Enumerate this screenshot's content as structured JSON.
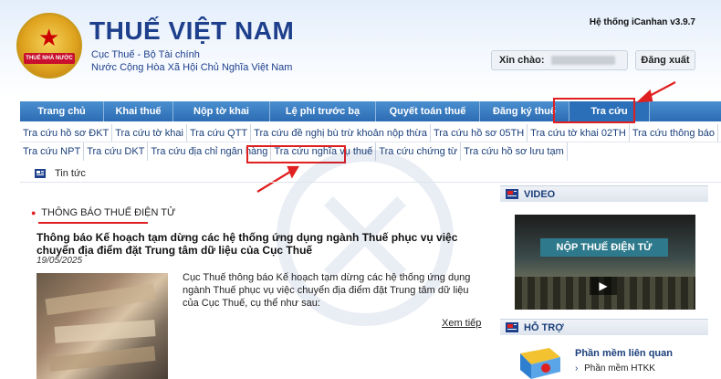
{
  "header": {
    "title": "THUẾ VIỆT NAM",
    "subtitle1": "Cục Thuế - Bộ Tài chính",
    "subtitle2": "Nước Cộng Hòa Xã Hội Chủ Nghĩa Việt Nam",
    "version": "Hệ thống iCanhan v3.9.7",
    "greeting_label": "Xin chào:",
    "logout_label": "Đăng xuất",
    "emblem_text": "THUẾ NHÀ NƯỚC"
  },
  "nav": {
    "items": [
      {
        "label": "Trang chủ"
      },
      {
        "label": "Khai thuế"
      },
      {
        "label": "Nộp tờ khai"
      },
      {
        "label": "Lệ phí trước bạ"
      },
      {
        "label": "Quyết toán thuế"
      },
      {
        "label": "Đăng ký thuế"
      },
      {
        "label": "Tra cứu"
      }
    ],
    "active": "Tra cứu"
  },
  "subnav": {
    "row1": [
      {
        "label": "Tra cứu hồ sơ ĐKT"
      },
      {
        "label": "Tra cứu tờ khai"
      },
      {
        "label": "Tra cứu QTT"
      },
      {
        "label": "Tra cứu đề nghị bù trừ khoản nộp thừa"
      },
      {
        "label": "Tra cứu hồ sơ 05TH"
      },
      {
        "label": "Tra cứu tờ khai 02TH"
      },
      {
        "label": "Tra cứu thông báo"
      }
    ],
    "row2": [
      {
        "label": "Tra cứu NPT"
      },
      {
        "label": "Tra cứu DKT"
      },
      {
        "label": "Tra cứu địa chỉ ngân hàng"
      },
      {
        "label": "Tra cứu nghĩa vụ thuế"
      },
      {
        "label": "Tra cứu chứng từ"
      },
      {
        "label": "Tra cứu hồ sơ lưu tạm"
      }
    ],
    "highlighted": "Tra cứu nghĩa vụ thuế"
  },
  "news_bar": {
    "label": "Tin tức"
  },
  "main": {
    "section_title": "THÔNG BÁO THUẾ ĐIỆN TỬ",
    "news_title": "Thông báo Kế hoạch tạm dừng các hệ thống ứng dụng ngành Thuế phục vụ việc chuyển địa điểm đặt Trung tâm dữ liệu của Cục Thuế",
    "news_date": "19/05/2025",
    "news_body": "Cục Thuế thông báo Kế hoạch tạm dừng các hệ thống ứng dụng ngành Thuế phục vụ việc chuyển địa điểm đặt Trung tâm dữ liệu của Cục Thuế, cụ thể như sau:",
    "more_label": "Xem tiếp"
  },
  "sidebar": {
    "video_label": "VIDEO",
    "video_caption": "NỘP THUẾ ĐIỆN TỬ",
    "support_label": "HỖ TRỢ",
    "support_title": "Phần mềm liên quan",
    "support_item": "Phần mềm HTKK"
  },
  "colors": {
    "nav_bg": "#2d6cb3",
    "brand_blue": "#1d3f8c",
    "highlight_red": "#e02020"
  }
}
